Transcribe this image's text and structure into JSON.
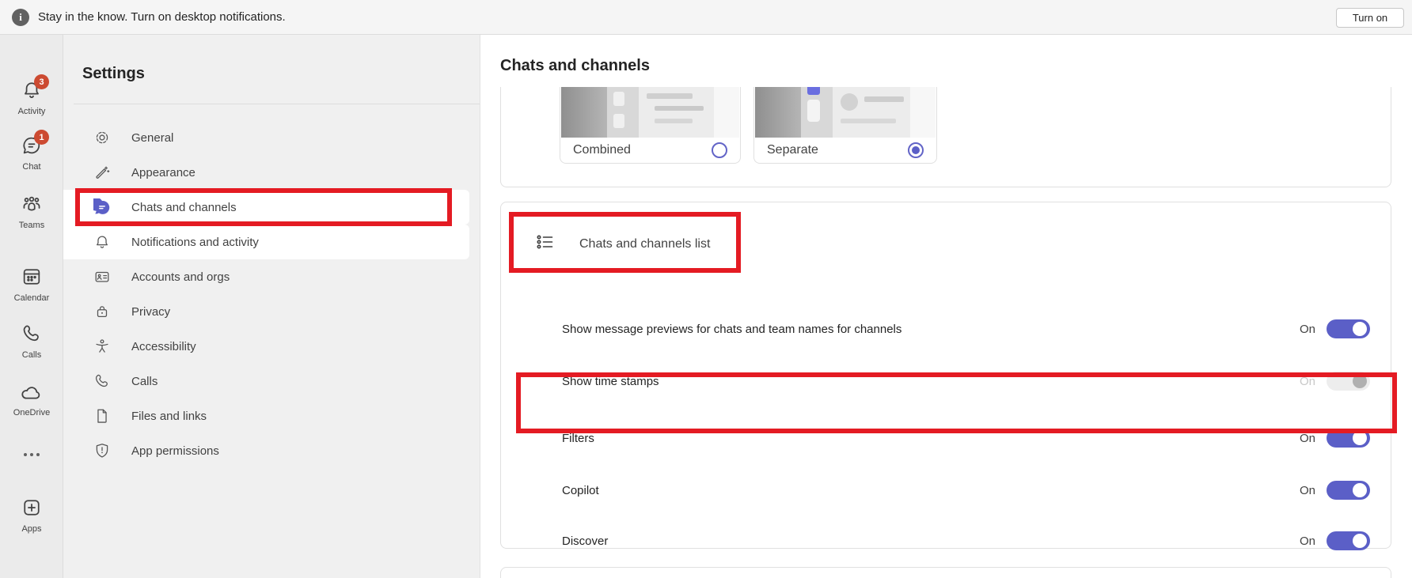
{
  "banner": {
    "message": "Stay in the know. Turn on desktop notifications.",
    "button_label": "Turn on"
  },
  "rail": {
    "items": [
      {
        "label": "Activity",
        "badge": "3"
      },
      {
        "label": "Chat",
        "badge": "1"
      },
      {
        "label": "Teams",
        "badge": ""
      },
      {
        "label": "Calendar",
        "badge": ""
      },
      {
        "label": "Calls",
        "badge": ""
      },
      {
        "label": "OneDrive",
        "badge": ""
      },
      {
        "label": "Apps",
        "badge": ""
      }
    ]
  },
  "settings": {
    "title": "Settings",
    "items": [
      {
        "label": "General"
      },
      {
        "label": "Appearance"
      },
      {
        "label": "Chats and channels",
        "selected": true,
        "annotated": true
      },
      {
        "label": "Notifications and activity",
        "highlighted": true
      },
      {
        "label": "Accounts and orgs"
      },
      {
        "label": "Privacy"
      },
      {
        "label": "Accessibility"
      },
      {
        "label": "Calls"
      },
      {
        "label": "Files and links"
      },
      {
        "label": "App permissions"
      }
    ]
  },
  "main": {
    "title": "Chats and channels",
    "display_options": [
      {
        "label": "Combined",
        "selected": false
      },
      {
        "label": "Separate",
        "selected": true
      }
    ],
    "list_section": {
      "title": "Chats and channels list",
      "annotated": true,
      "rows": [
        {
          "label": "Show message previews for chats and team names for channels",
          "value": "On",
          "enabled": true
        },
        {
          "label": "Show time stamps",
          "value": "On",
          "enabled": false
        },
        {
          "label": "Filters",
          "value": "On",
          "enabled": true,
          "annotated": true
        },
        {
          "label": "Copilot",
          "value": "On",
          "enabled": true
        },
        {
          "label": "Discover",
          "value": "On",
          "enabled": true
        }
      ]
    }
  },
  "colors": {
    "accent": "#5b5fc7",
    "badge": "#cc4a31",
    "annotation": "#e41b23"
  }
}
